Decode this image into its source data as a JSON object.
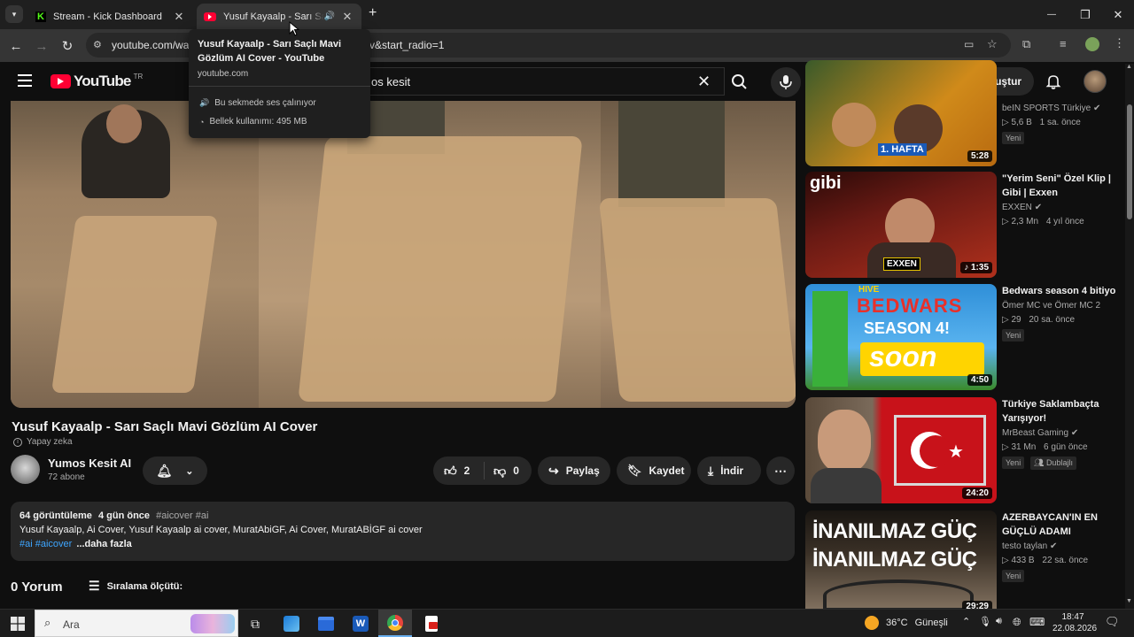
{
  "browser": {
    "tabs": [
      {
        "title": "Stream - Kick Dashboard",
        "active": false
      },
      {
        "title": "Yusuf Kayaalp - Sarı Saçlı M",
        "active": true
      }
    ],
    "new_tab": "+",
    "url_start": "youtube.com/wat",
    "url_end": "v&start_radio=1",
    "window_controls": {
      "minimize": "—",
      "maximize": "❐",
      "close": "✕"
    }
  },
  "tooltip": {
    "title": "Yusuf Kayaalp - Sarı Saçlı Mavi Gözlüm AI Cover - YouTube",
    "domain": "youtube.com",
    "audio": "Bu sekmede ses çalınıyor",
    "memory": "Bellek kullanımı: 495 MB"
  },
  "youtube": {
    "logo_text": "YouTube",
    "region": "TR",
    "search_value": "os kesit",
    "create_label": "Oluştur"
  },
  "video": {
    "title": "Yusuf Kayaalp - Sarı Saçlı Mavi Gözlüm AI Cover",
    "ai_label": "Yapay zeka",
    "channel_name": "Yumos Kesit AI",
    "subscribers": "72 abone",
    "likes": "2",
    "dislikes": "0",
    "share": "Paylaş",
    "save": "Kaydet",
    "download": "İndir",
    "more": "⋯"
  },
  "description": {
    "views": "64 görüntüleme",
    "age": "4 gün önce",
    "tags_top": "#aicover #ai",
    "text": "Yusuf Kayaalp, Ai Cover, Yusuf Kayaalp ai cover, MuratAbiGF, Ai Cover, MuratABİGF ai cover",
    "tags_bottom": "#ai #aicover",
    "more": "...daha fazla"
  },
  "comments": {
    "count": "0 Yorum",
    "sort": "Sıralama ölçütü:"
  },
  "recommendations": [
    {
      "title": "",
      "channel": "beIN SPORTS Türkiye",
      "views": "▷ 5,6 B",
      "age": "1 sa. önce",
      "badge": "Yeni",
      "duration": "5:28",
      "thumb_text": "1. HAFTA",
      "colors": [
        "#3a5a2a",
        "#d08a1a"
      ]
    },
    {
      "title": "\"Yerim Seni\" Özel Klip | Gibi | Exxen",
      "channel": "EXXEN",
      "views": "▷ 2,3 Mn",
      "age": "4 yıl önce",
      "badge": "",
      "duration": "1:35",
      "thumb_text": "gibi",
      "thumb_text2": "EXXEN",
      "colors": [
        "#6a1a14",
        "#b0301c"
      ]
    },
    {
      "title": "Bedwars season 4 bitiyo",
      "channel": "Ömer MC ve Ömer MC 2",
      "views": "▷ 29",
      "age": "20 sa. önce",
      "badge": "Yeni",
      "duration": "4:50",
      "thumb_text": "BEDWARS",
      "thumb_text2": "SEASON 4!",
      "thumb_text3": "soon",
      "thumb_text4": "HIVE",
      "colors": [
        "#2f8fd8",
        "#ffd400"
      ]
    },
    {
      "title": "Türkiye Saklambaçta Yarışıyor!",
      "channel": "MrBeast Gaming",
      "views": "▷ 31 Mn",
      "age": "6 gün önce",
      "badge": "Yeni",
      "badge2": "Dublajlı",
      "duration": "24:20",
      "colors": [
        "#c8121a",
        "#5a4a3a"
      ]
    },
    {
      "title": "AZERBAYCAN'IN EN GÜÇLÜ ADAMI",
      "channel": "testo taylan",
      "views": "▷ 433 B",
      "age": "22 sa. önce",
      "badge": "Yeni",
      "duration": "29:29",
      "thumb_text": "İNANILMAZ GÜÇ",
      "thumb_text2": "İNANILMAZ GÜÇ",
      "colors": [
        "#3a3026",
        "#8a7866"
      ]
    }
  ],
  "taskbar": {
    "search_placeholder": "Ara",
    "weather": "36°C",
    "weather_desc": "Güneşli",
    "time": "18:47",
    "date": "22.08.2026"
  },
  "colors": {
    "accent_red": "#ff0033",
    "kick_green": "#53fc18"
  }
}
